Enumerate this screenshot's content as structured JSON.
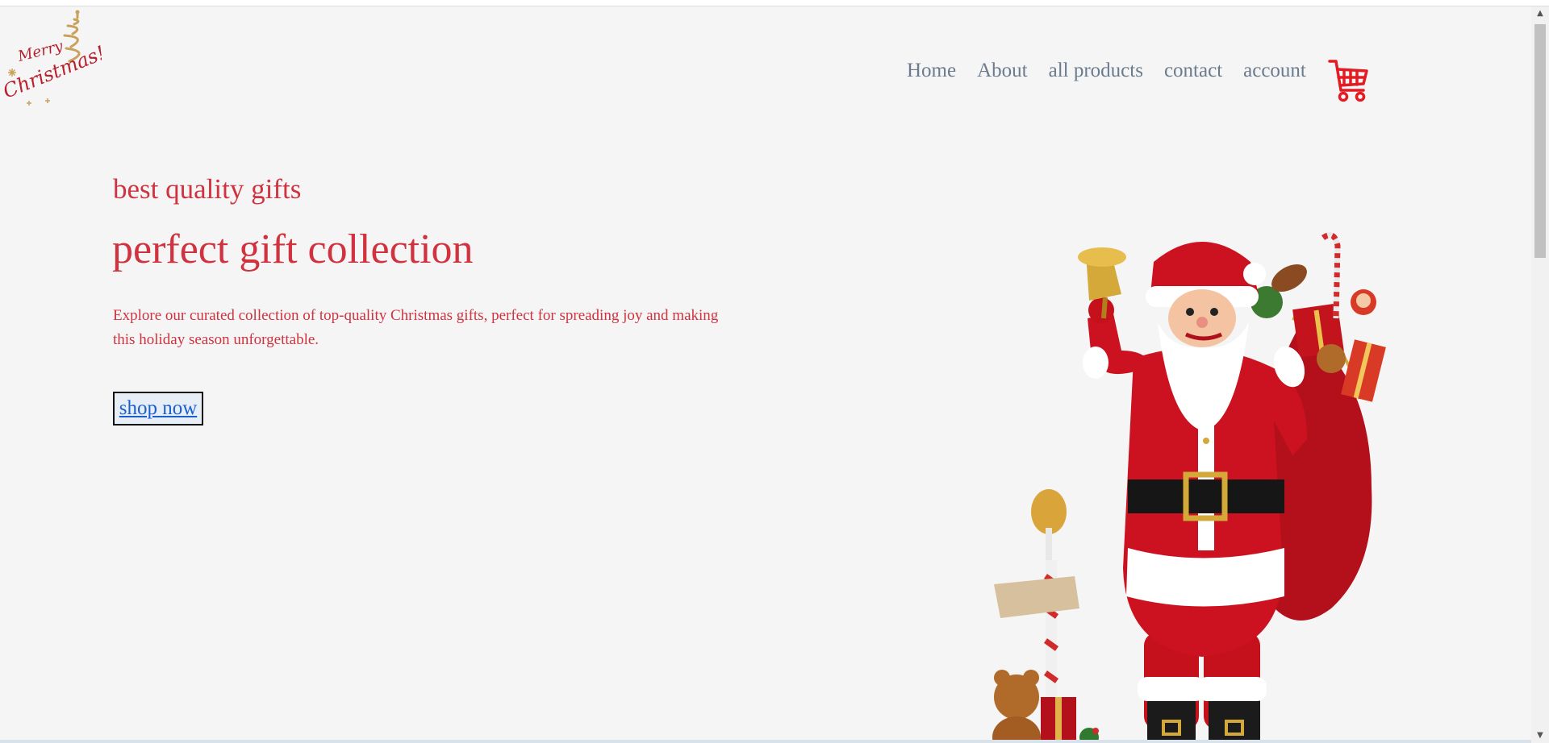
{
  "logo": {
    "text_line1": "Merry",
    "text_line2": "Christmas!"
  },
  "nav": {
    "items": [
      {
        "label": "Home"
      },
      {
        "label": "About"
      },
      {
        "label": "all products"
      },
      {
        "label": "contact"
      },
      {
        "label": "account"
      }
    ],
    "cart_icon": "shopping-cart-icon"
  },
  "hero": {
    "subtitle": "best quality gifts",
    "title": "perfect gift collection",
    "description": "Explore our curated collection of top-quality Christmas gifts, perfect for spreading joy and making this holiday season unforgettable.",
    "button_label": "shop now"
  },
  "colors": {
    "accent": "#d0323f",
    "nav_text": "#6b7b8e",
    "link": "#1a5fd0",
    "background": "#f5f5f5",
    "logo_gold": "#c9a15a",
    "logo_red": "#b8202c"
  },
  "scrollbar": {
    "up_icon": "chevron-up-icon",
    "down_icon": "chevron-down-icon"
  }
}
